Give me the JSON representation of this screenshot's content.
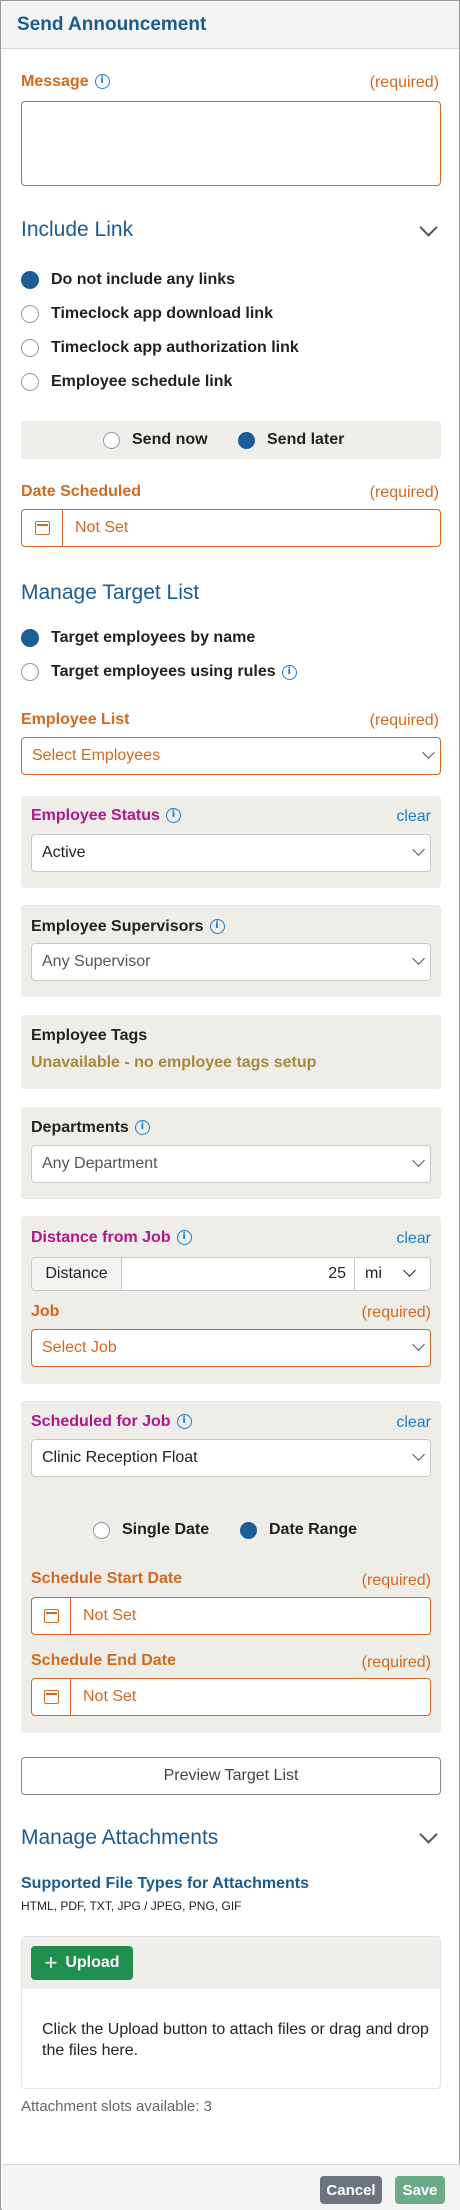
{
  "header": {
    "title": "Send Announcement"
  },
  "message": {
    "label": "Message",
    "required": "(required)",
    "value": ""
  },
  "include_link": {
    "title": "Include Link",
    "options": [
      {
        "label": "Do not include any links",
        "selected": true
      },
      {
        "label": "Timeclock app download link",
        "selected": false
      },
      {
        "label": "Timeclock app authorization link",
        "selected": false
      },
      {
        "label": "Employee schedule link",
        "selected": false
      }
    ]
  },
  "send_mode": {
    "send_now": "Send now",
    "send_later": "Send later",
    "selected": "send_later"
  },
  "date_scheduled": {
    "label": "Date Scheduled",
    "required": "(required)",
    "value": "Not Set"
  },
  "target_list": {
    "title": "Manage Target List",
    "by_name": "Target employees by name",
    "by_rules": "Target employees using rules",
    "selected": "by_name"
  },
  "employee_list": {
    "label": "Employee List",
    "required": "(required)",
    "placeholder": "Select Employees"
  },
  "employee_status": {
    "label": "Employee Status",
    "clear": "clear",
    "value": "Active"
  },
  "employee_supervisors": {
    "label": "Employee Supervisors",
    "value": "Any Supervisor"
  },
  "employee_tags": {
    "label": "Employee Tags",
    "message": "Unavailable - no employee tags setup"
  },
  "departments": {
    "label": "Departments",
    "value": "Any Department"
  },
  "distance_from_job": {
    "label": "Distance from Job",
    "clear": "clear",
    "distance_label": "Distance",
    "distance_value": "25",
    "unit": "mi",
    "job_label": "Job",
    "job_required": "(required)",
    "job_placeholder": "Select Job"
  },
  "scheduled_for_job": {
    "label": "Scheduled for Job",
    "clear": "clear",
    "value": "Clinic Reception Float",
    "single_date": "Single Date",
    "date_range": "Date Range",
    "selected": "date_range",
    "start_label": "Schedule Start Date",
    "start_required": "(required)",
    "start_value": "Not Set",
    "end_label": "Schedule End Date",
    "end_required": "(required)",
    "end_value": "Not Set"
  },
  "preview_button": "Preview Target List",
  "attachments": {
    "title": "Manage Attachments",
    "supported_title": "Supported File Types for Attachments",
    "supported_types": "HTML, PDF, TXT, JPG / JPEG, PNG, GIF",
    "upload_label": "Upload",
    "drop_text": "Click the Upload button to attach files or drag and drop the files here.",
    "slots": "Attachment slots available: 3"
  },
  "footer": {
    "cancel": "Cancel",
    "save": "Save"
  },
  "colors": {
    "title_blue": "#1a5c8e",
    "required_orange": "#d2691e",
    "rule_magenta": "#b1168a",
    "link_blue": "#1a7fd0",
    "upload_green": "#1f8f4e",
    "save_green": "#6aab88",
    "cancel_gray": "#6c757d"
  }
}
